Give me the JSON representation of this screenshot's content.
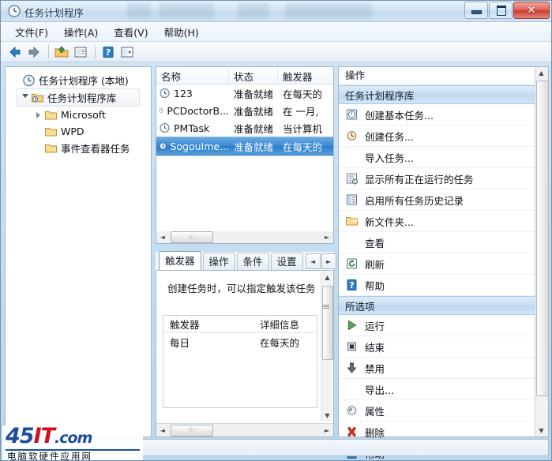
{
  "window": {
    "title": "任务计划程序",
    "icon": "clock-icon",
    "controls": {
      "minimize": "minimize-button",
      "maximize": "maximize-button",
      "close_label": "✕"
    }
  },
  "menubar": {
    "items": [
      {
        "label": "文件(F)"
      },
      {
        "label": "操作(A)"
      },
      {
        "label": "查看(V)"
      },
      {
        "label": "帮助(H)"
      }
    ]
  },
  "toolbar": {
    "buttons": [
      {
        "name": "back-icon"
      },
      {
        "name": "forward-icon"
      },
      {
        "name": "up-folder-icon"
      },
      {
        "name": "properties-icon"
      },
      {
        "name": "help-icon"
      },
      {
        "name": "show-pane-icon"
      }
    ]
  },
  "tree": {
    "items": [
      {
        "label": "任务计划程序 (本地)",
        "level": 0,
        "icon": "clock-icon",
        "expander": "none",
        "selected": false
      },
      {
        "label": "任务计划程序库",
        "level": 1,
        "icon": "folder-clock-icon",
        "expander": "open",
        "selected": true
      },
      {
        "label": "Microsoft",
        "level": 2,
        "icon": "folder-icon",
        "expander": "closed",
        "selected": false
      },
      {
        "label": "WPD",
        "level": 2,
        "icon": "folder-icon",
        "expander": "none",
        "selected": false
      },
      {
        "label": "事件查看器任务",
        "level": 2,
        "icon": "folder-icon",
        "expander": "none",
        "selected": false
      }
    ]
  },
  "task_list": {
    "columns": [
      "名称",
      "状态",
      "触发器"
    ],
    "rows": [
      {
        "name": "123",
        "status": "准备就绪",
        "trigger": "在每天的",
        "selected": false
      },
      {
        "name": "PCDoctorB...",
        "status": "准备就绪",
        "trigger": "在 一月, ",
        "selected": false
      },
      {
        "name": "PMTask",
        "status": "准备就绪",
        "trigger": "当计算机",
        "selected": false
      },
      {
        "name": "SogouIme...",
        "status": "准备就绪",
        "trigger": "在每天的",
        "selected": true
      }
    ]
  },
  "detail": {
    "tabs": [
      {
        "label": "触发器",
        "active": true
      },
      {
        "label": "操作",
        "active": false
      },
      {
        "label": "条件",
        "active": false
      },
      {
        "label": "设置",
        "active": false
      }
    ],
    "description": "创建任务时，可以指定触发该任务",
    "inner_columns": [
      "触发器",
      "详细信息"
    ],
    "inner_rows": [
      {
        "trigger": "每日",
        "details": "在每天的"
      }
    ]
  },
  "actions": {
    "title": "操作",
    "sections": [
      {
        "header": "任务计划程序库",
        "items": [
          {
            "label": "创建基本任务...",
            "icon": "new-basic-task-icon",
            "submenu": false
          },
          {
            "label": "创建任务...",
            "icon": "new-task-icon",
            "submenu": false
          },
          {
            "label": "导入任务...",
            "icon": "none",
            "submenu": false
          },
          {
            "label": "显示所有正在运行的任务",
            "icon": "running-tasks-icon",
            "submenu": false
          },
          {
            "label": "启用所有任务历史记录",
            "icon": "history-icon",
            "submenu": false
          },
          {
            "label": "新文件夹...",
            "icon": "new-folder-icon",
            "submenu": false
          },
          {
            "label": "查看",
            "icon": "none",
            "submenu": true
          },
          {
            "label": "刷新",
            "icon": "refresh-icon",
            "submenu": false
          },
          {
            "label": "帮助",
            "icon": "help-icon",
            "submenu": false
          }
        ]
      },
      {
        "header": "所选项",
        "items": [
          {
            "label": "运行",
            "icon": "run-icon",
            "submenu": false
          },
          {
            "label": "结束",
            "icon": "stop-icon",
            "submenu": false
          },
          {
            "label": "禁用",
            "icon": "disable-icon",
            "submenu": false
          },
          {
            "label": "导出...",
            "icon": "none",
            "submenu": false
          },
          {
            "label": "属性",
            "icon": "properties-icon",
            "submenu": false
          },
          {
            "label": "删除",
            "icon": "delete-icon",
            "submenu": false
          },
          {
            "label": "帮助",
            "icon": "help-icon",
            "submenu": false
          }
        ]
      }
    ]
  },
  "watermark": {
    "text_45": "45",
    "text_it": "IT",
    "text_com": ".com",
    "subtitle": "电脑软硬件应用网"
  },
  "colors": {
    "selection_blue": "#3d8ad6",
    "section_header": "#c8def2",
    "close_red": "#c93c30"
  }
}
